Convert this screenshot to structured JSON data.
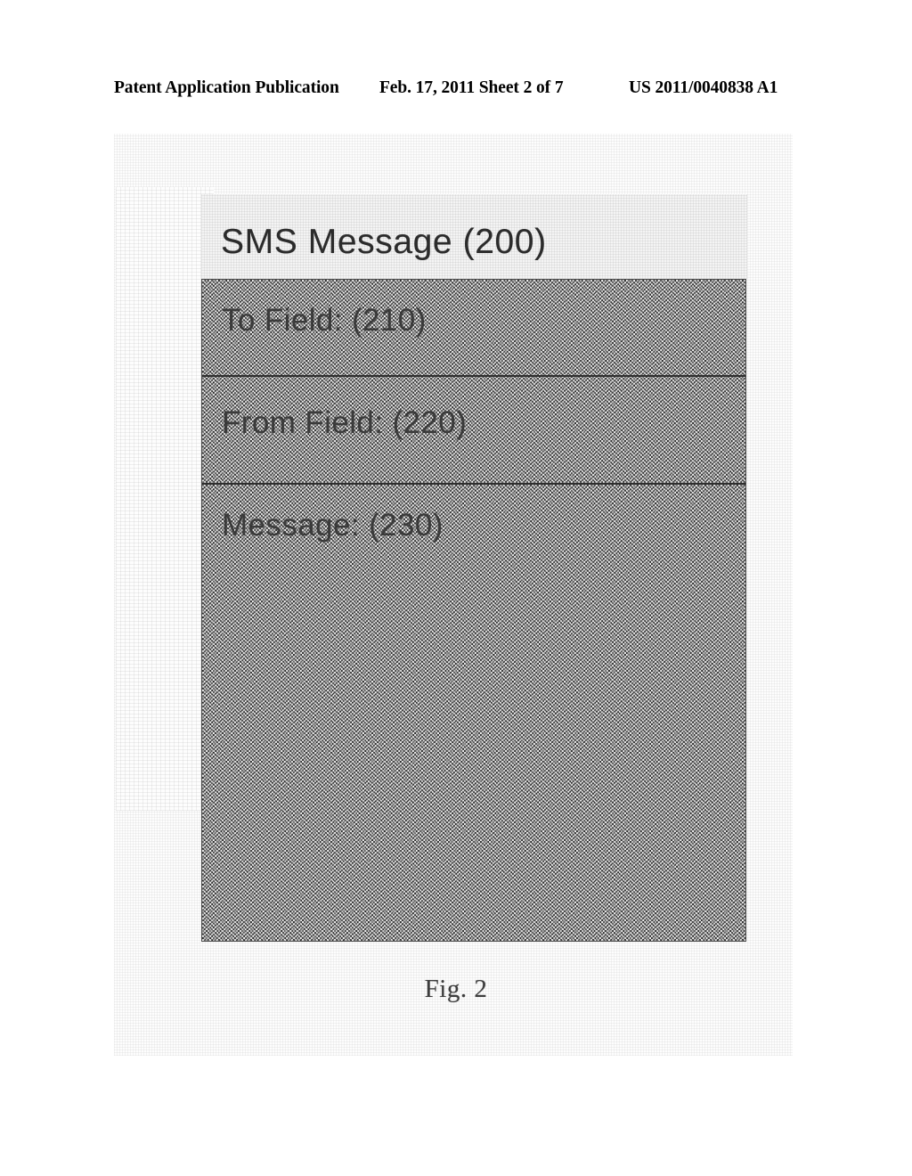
{
  "header": {
    "publication": "Patent Application Publication",
    "date_sheet": "Feb. 17, 2011   Sheet 2 of 7",
    "doc_id": "US 2011/0040838 A1"
  },
  "figure": {
    "title": "SMS Message (200)",
    "caption": "Fig. 2",
    "rows": [
      {
        "label": "To Field: (210)"
      },
      {
        "label": "From Field: (220)"
      },
      {
        "label": "Message: (230)"
      }
    ]
  },
  "colors": {
    "page_background": "#ffffff",
    "text": "#000000",
    "figure_fill_gray": "#8a8a8a",
    "figure_border": "#4a4a4a"
  }
}
